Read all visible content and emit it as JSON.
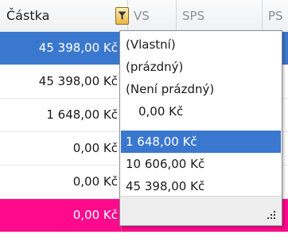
{
  "columns": {
    "castka": "Částka",
    "vs": "VS",
    "sps": "SPS",
    "ps": "PS"
  },
  "rows": [
    {
      "amount": "45 398,00 Kč",
      "state": "selected"
    },
    {
      "amount": "45 398,00 Kč",
      "state": "normal"
    },
    {
      "amount": "1 648,00 Kč",
      "state": "normal"
    },
    {
      "amount": "0,00 Kč",
      "state": "normal"
    },
    {
      "amount": "0,00 Kč",
      "state": "normal"
    },
    {
      "amount": "0,00 Kč",
      "state": "highlighted"
    }
  ],
  "filter_popup": {
    "items": [
      {
        "label": "(Vlastní)",
        "selected": false
      },
      {
        "label": "(prázdný)",
        "selected": false
      },
      {
        "label": "(Není prázdný)",
        "selected": false
      },
      {
        "label": "0,00 Kč",
        "selected": false
      },
      {
        "label": "1 648,00 Kč",
        "selected": true
      },
      {
        "label": "10 606,00 Kč",
        "selected": false
      },
      {
        "label": "45 398,00 Kč",
        "selected": false
      }
    ]
  },
  "icons": {
    "filter": "filter-funnel-icon",
    "resize": "resize-grip-icon"
  },
  "colors": {
    "selection": "#3a78cf",
    "highlight_row": "#ff0a8c",
    "filter_button": "#e9b642"
  }
}
